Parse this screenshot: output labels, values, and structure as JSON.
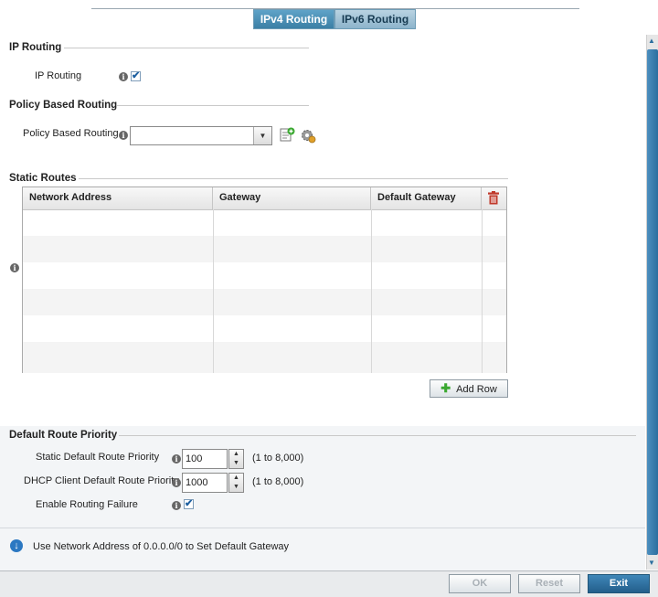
{
  "tabs": [
    {
      "label": "IPv4 Routing",
      "active": true
    },
    {
      "label": "IPv6 Routing",
      "active": false
    }
  ],
  "ip_routing": {
    "section_title": "IP Routing",
    "label": "IP Routing",
    "checked": true,
    "check_glyph": "✔"
  },
  "policy_based_routing": {
    "section_title": "Policy Based Routing",
    "label": "Policy Based Routing",
    "selected_value": "",
    "dropdown_glyph": "▼"
  },
  "static_routes": {
    "section_title": "Static Routes",
    "columns": [
      "Network Address",
      "Gateway",
      "Default Gateway"
    ],
    "rows": [],
    "add_row_label": "Add Row",
    "add_glyph": "✚"
  },
  "default_route_priority": {
    "section_title": "Default Route Priority",
    "static_label": "Static Default Route Priority",
    "static_value": "100",
    "static_range": "(1 to 8,000)",
    "dhcp_label": "DHCP Client Default Route Priority",
    "dhcp_value": "1000",
    "dhcp_range": "(1 to 8,000)",
    "failure_label": "Enable Routing Failure",
    "failure_checked": true
  },
  "note": {
    "text": "Use Network Address of 0.0.0.0/0 to Set Default Gateway",
    "glyph": "↓"
  },
  "footer": {
    "ok_label": "OK",
    "reset_label": "Reset",
    "exit_label": "Exit"
  },
  "glyphs": {
    "info": "i",
    "spin_up": "▲",
    "spin_down": "▼"
  },
  "colors": {
    "accent": "#3b7fa5",
    "delete_icon": "#c0392b",
    "add_icon": "#3aa830",
    "exit_button": "#2b6f9f"
  }
}
